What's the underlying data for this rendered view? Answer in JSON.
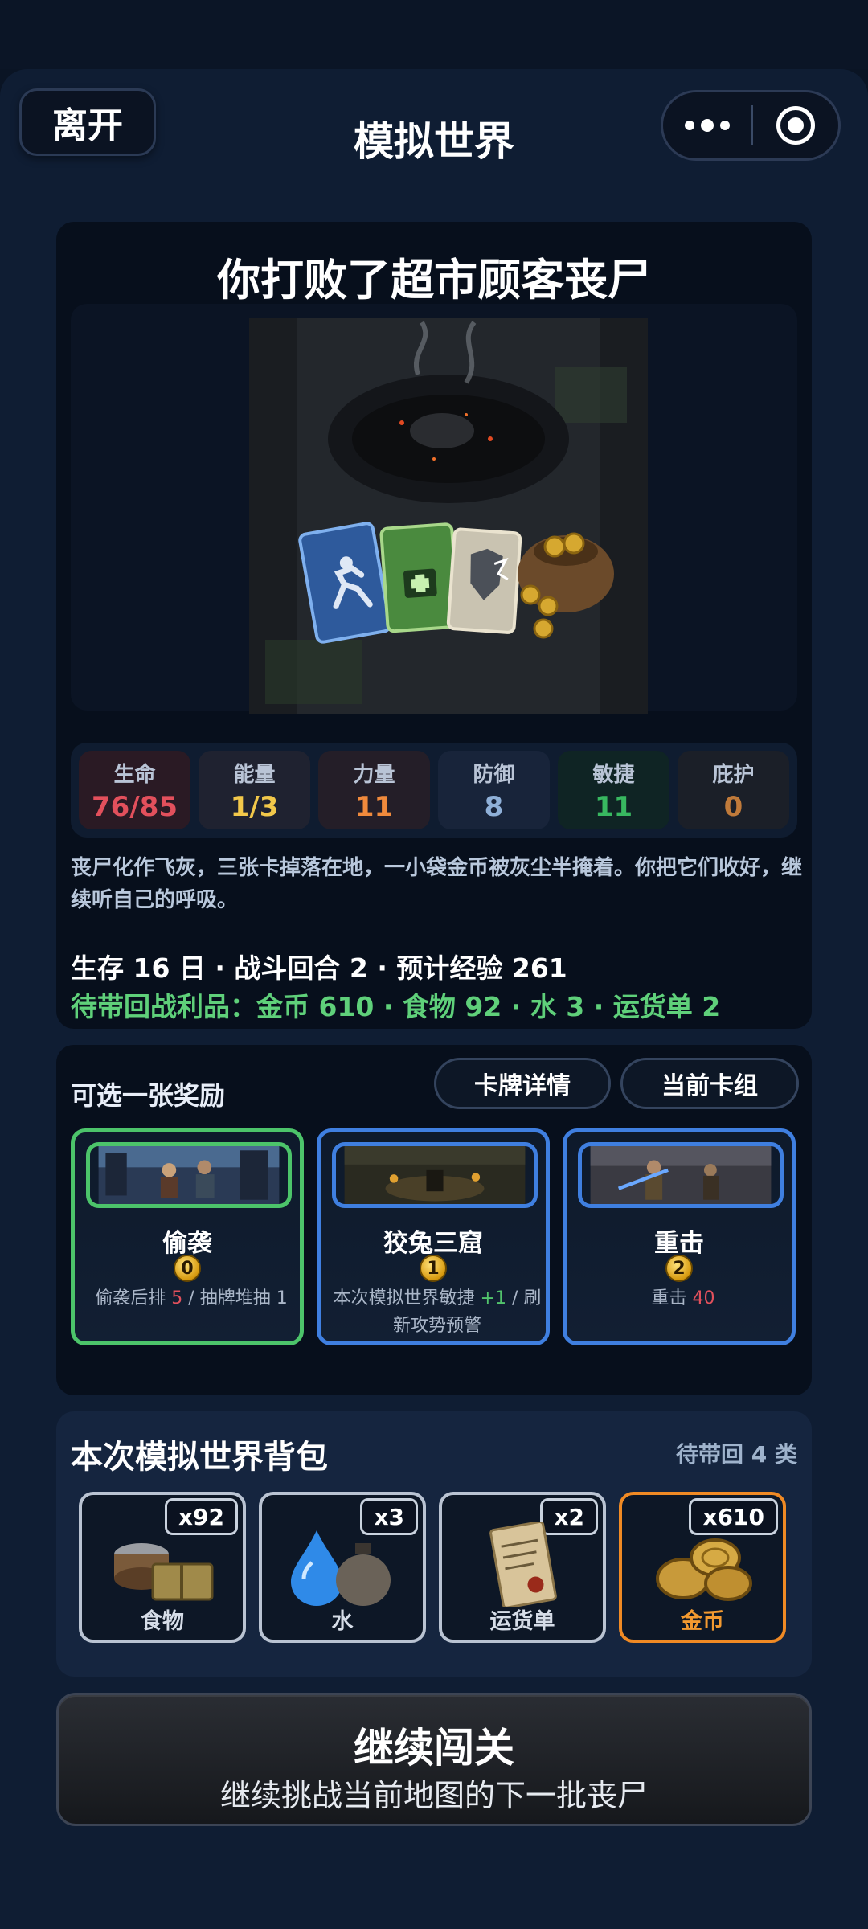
{
  "header": {
    "leave_label": "离开",
    "title": "模拟世界",
    "more_icon": "more-dots-icon",
    "target_icon": "record-target-icon"
  },
  "result": {
    "title": "你打败了超市顾客丧尸",
    "stats": [
      {
        "label": "生命",
        "value": "76/85",
        "color": "#e2505c",
        "bg": "#2a1a24"
      },
      {
        "label": "能量",
        "value": "1/3",
        "color": "#f2c84a",
        "bg": "#1f2230"
      },
      {
        "label": "力量",
        "value": "11",
        "color": "#f08a3c",
        "bg": "#241e28"
      },
      {
        "label": "防御",
        "value": "8",
        "color": "#8fb0d8",
        "bg": "#18243a"
      },
      {
        "label": "敏捷",
        "value": "11",
        "color": "#38b860",
        "bg": "#0f2424"
      },
      {
        "label": "庇护",
        "value": "0",
        "color": "#c07a3a",
        "bg": "#1b1f28"
      }
    ],
    "description": "丧尸化作飞灰，三张卡掉落在地，一小袋金币被灰尘半掩着。你把它们收好，继续听自己的呼吸。",
    "survive_line": "生存 16 日 · 战斗回合 2 · 预计经验 261",
    "loot_line": "待带回战利品：金币 610 · 食物 92 · 水 3 · 运货单 2"
  },
  "reward": {
    "label": "可选一张奖励",
    "details_button": "卡牌详情",
    "deck_button": "当前卡组",
    "cards": [
      {
        "name": "偷袭",
        "cost": "0",
        "effect_prefix": "偷袭后排 ",
        "effect_hl": "5",
        "effect_suffix": " / 抽牌堆抽 1",
        "border": "#4cc46a"
      },
      {
        "name": "狡兔三窟",
        "cost": "1",
        "effect_prefix": "本次模拟世界敏捷 ",
        "effect_hl": "+1",
        "effect_suffix": " / 刷新攻势预警",
        "border": "#3f7fe0"
      },
      {
        "name": "重击",
        "cost": "2",
        "effect_prefix": "重击 ",
        "effect_hl": "40",
        "effect_suffix": "",
        "border": "#3f7fe0"
      }
    ]
  },
  "backpack": {
    "title": "本次模拟世界背包",
    "count": "待带回 4 类",
    "items": [
      {
        "name": "食物",
        "qty": "x92",
        "icon": "food-icon"
      },
      {
        "name": "水",
        "qty": "x3",
        "icon": "water-icon"
      },
      {
        "name": "运货单",
        "qty": "x2",
        "icon": "waybill-icon"
      },
      {
        "name": "金币",
        "qty": "x610",
        "icon": "gold-coins-icon"
      }
    ]
  },
  "continue": {
    "title": "继续闯关",
    "subtitle": "继续挑战当前地图的下一批丧尸"
  }
}
